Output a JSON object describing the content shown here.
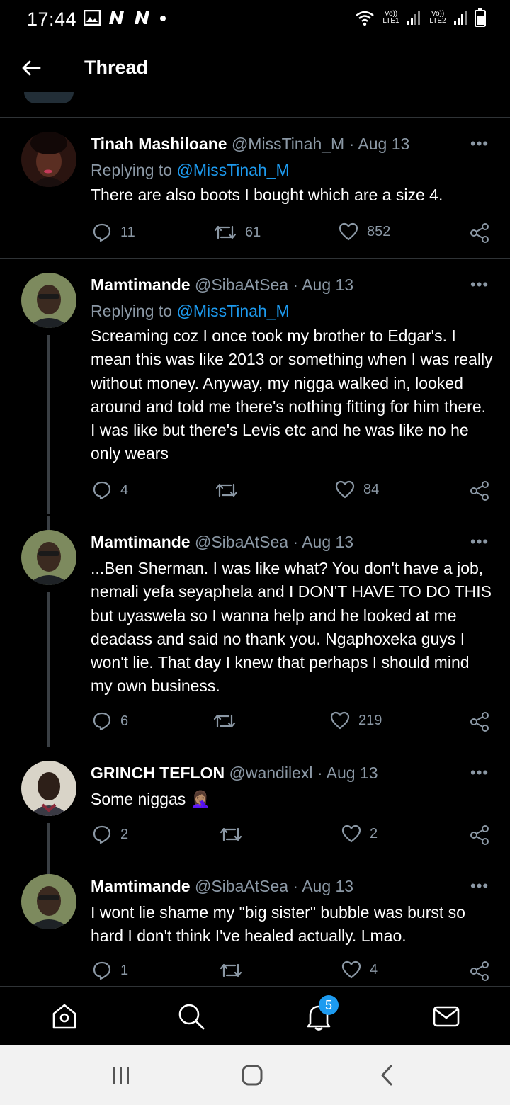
{
  "status_bar": {
    "time": "17:44",
    "sim1_label": "Vo)) LTE1",
    "sim2_label": "Vo)) LTE2",
    "icons": [
      "gallery-icon",
      "n-app-icon",
      "n-app-icon",
      "dot-icon",
      "wifi-icon",
      "signal-icon",
      "battery-icon"
    ]
  },
  "header": {
    "title": "Thread",
    "back_icon": "arrow-left-icon"
  },
  "tweets": [
    {
      "name": "Tinah Mashiloane",
      "handle": "@MissTinah_M",
      "date": "· Aug 13",
      "replying_label": "Replying to",
      "replying_handle": "@MissTinah_M",
      "text": "There are also boots I bought which are a size 4.",
      "replies": "11",
      "retweets": "61",
      "likes": "852"
    },
    {
      "name": "Mamtimande",
      "handle": "@SibaAtSea",
      "date": "· Aug 13",
      "replying_label": "Replying to",
      "replying_handle": "@MissTinah_M",
      "text": "Screaming coz I once took my brother to Edgar's. I mean this was like 2013 or something when I was really without money. Anyway, my nigga walked in, looked around and told me there's nothing fitting for him there. I was like but there's Levis etc and he was like no he only wears",
      "replies": "4",
      "retweets": "",
      "likes": "84"
    },
    {
      "name": "Mamtimande",
      "handle": "@SibaAtSea",
      "date": "· Aug 13",
      "text": "...Ben Sherman. I was like what? You don't have a job, nemali yefa seyaphela and I DON'T HAVE TO DO THIS but uyaswela so I wanna help and he looked at me deadass and said no thank you. Ngaphoxeka guys I won't lie. That day I knew that perhaps I should mind my own business.",
      "replies": "6",
      "retweets": "",
      "likes": "219"
    },
    {
      "name": "GRINCH TEFLON",
      "handle": "@wandilexl",
      "date": "· Aug 13",
      "text": "Some niggas 🤦🏽‍♀️",
      "replies": "2",
      "retweets": "",
      "likes": "2"
    },
    {
      "name": "Mamtimande",
      "handle": "@SibaAtSea",
      "date": "· Aug 13",
      "text": "I wont lie shame my \"big sister\" bubble was burst so hard I don't think I've healed actually.  Lmao.",
      "replies": "1",
      "retweets": "",
      "likes": "4"
    }
  ],
  "more_label": "•••",
  "bottom_nav": {
    "items": [
      "home-icon",
      "search-icon",
      "notifications-icon",
      "messages-icon"
    ],
    "notification_badge": "5"
  },
  "system_nav": [
    "recents-icon",
    "home-button-icon",
    "back-icon"
  ]
}
